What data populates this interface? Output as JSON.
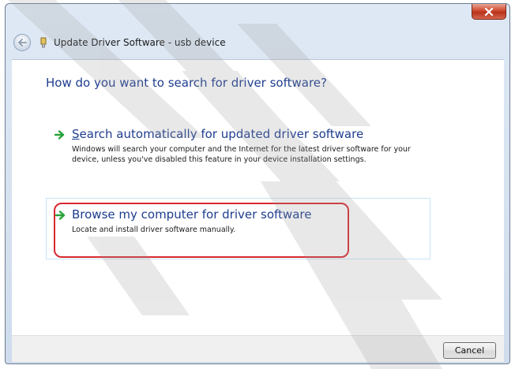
{
  "window": {
    "title": "Update Driver Software - usb device",
    "close_label": "x"
  },
  "main": {
    "heading": "How do you want to search for driver software?",
    "options": [
      {
        "title": "Search automatically for updated driver software",
        "accesskey": "S",
        "description": "Windows will search your computer and the Internet for the latest driver software for your device, unless you've disabled this feature in your device installation settings."
      },
      {
        "title": "Browse my computer for driver software",
        "description": "Locate and install driver software manually."
      }
    ]
  },
  "footer": {
    "cancel_label": "Cancel"
  },
  "colors": {
    "link_blue": "#1e3d8f",
    "arrow_green": "#2aa33a",
    "highlight_red": "#d9282f",
    "close_red": "#cf4a30"
  },
  "icons": {
    "back": "back-arrow-icon",
    "device": "usb-device-icon",
    "option_arrow": "green-arrow-icon",
    "close": "close-icon"
  }
}
